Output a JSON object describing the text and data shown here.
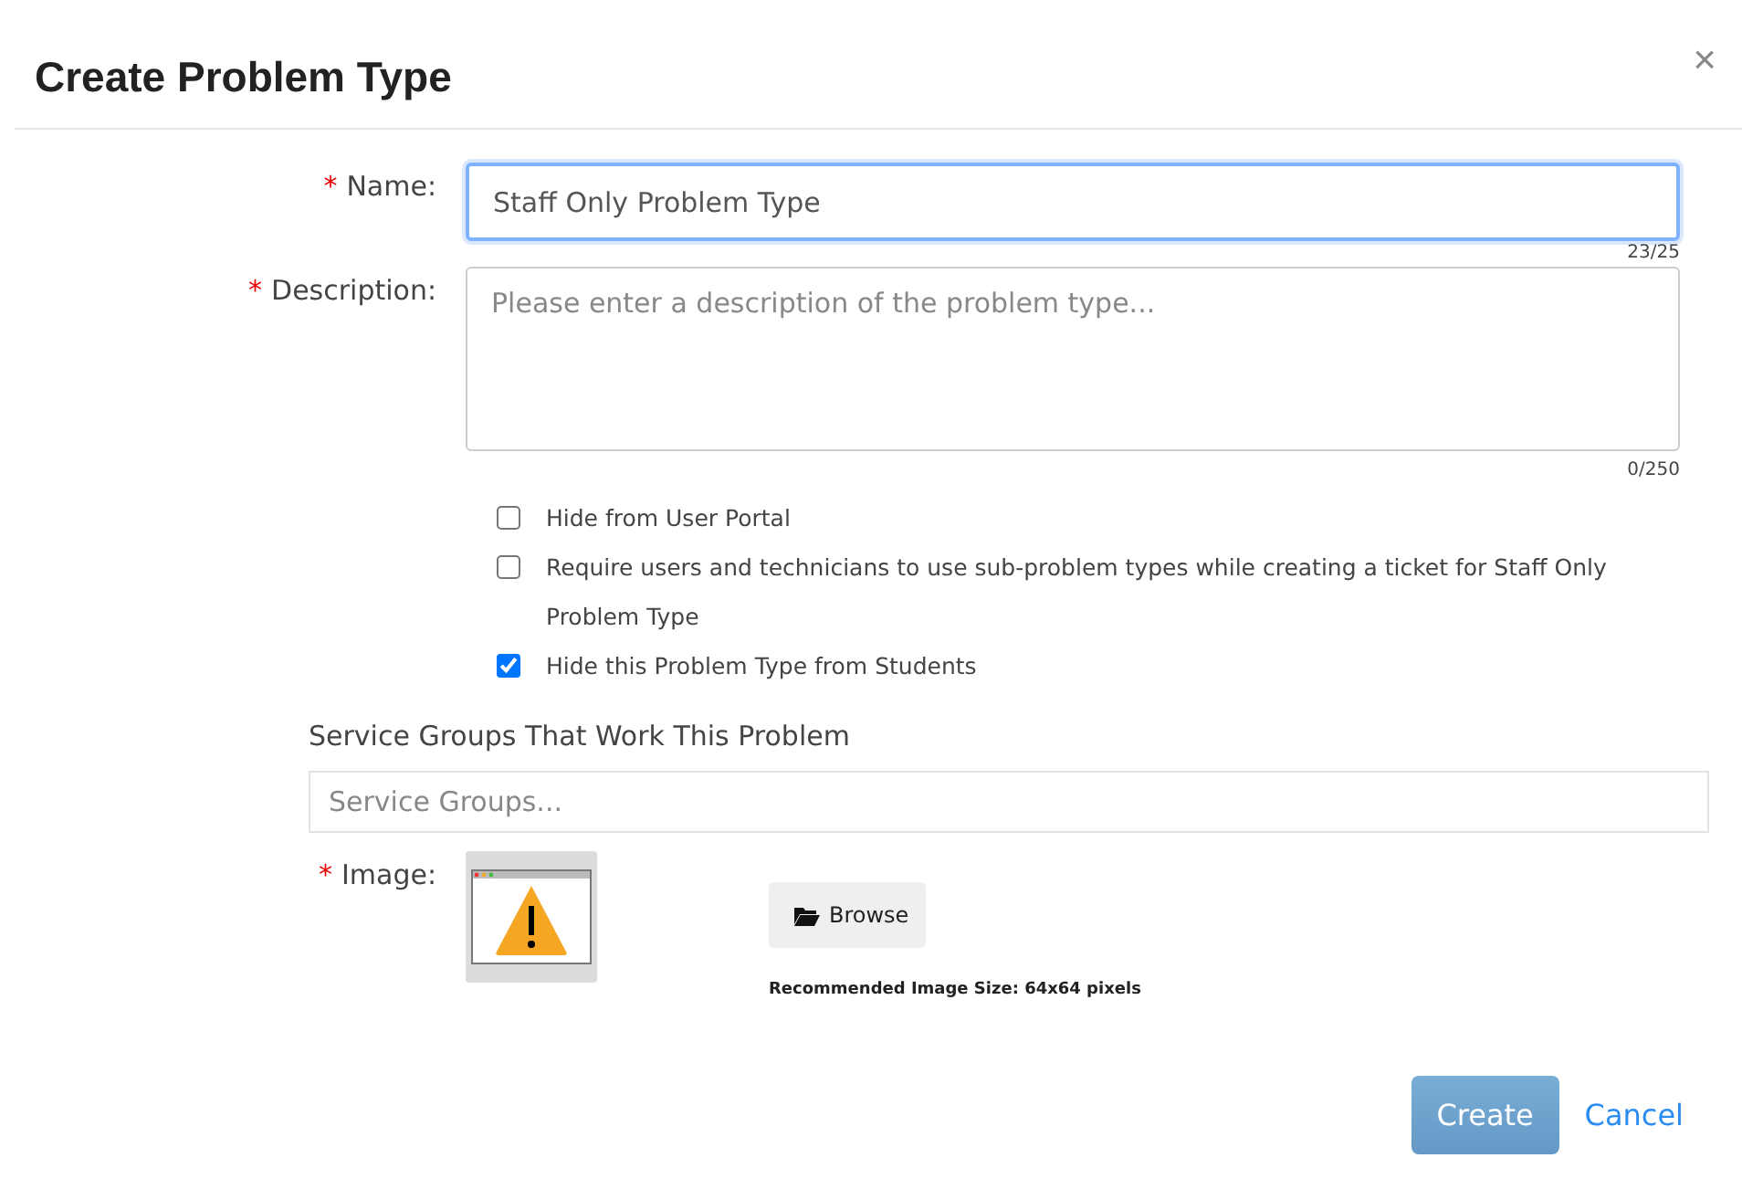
{
  "dialog": {
    "title": "Create Problem Type",
    "close": "×"
  },
  "fields": [
    {
      "label": "Name:",
      "required_mark": "*",
      "value": "Staff Only Problem Type",
      "counter": "23/25",
      "focused": true
    },
    {
      "label": "Description:",
      "required_mark": "*",
      "placeholder": "Please enter a description of the problem type...",
      "counter": "0/250",
      "focused": false
    }
  ],
  "options": [
    {
      "label": "Hide from User Portal",
      "checked": false
    },
    {
      "label": "Require users and technicians to use sub-problem types while creating a ticket for Staff Only Problem Type",
      "checked": false
    },
    {
      "label": "Hide this Problem Type from Students",
      "checked": true
    }
  ],
  "service_groups": {
    "heading": "Service Groups That Work This Problem",
    "placeholder": "Service Groups..."
  },
  "image": {
    "label": "Image:",
    "required_mark": "*",
    "browse": "Browse",
    "hint": "Recommended Image Size: 64x64 pixels"
  },
  "buttons": {
    "create": "Create",
    "cancel": "Cancel"
  }
}
